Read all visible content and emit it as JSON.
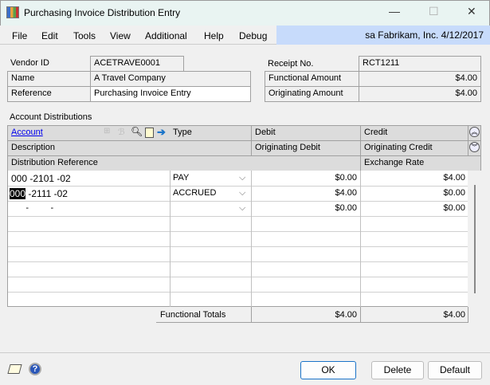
{
  "window": {
    "title": "Purchasing Invoice Distribution Entry",
    "minimize": "—",
    "maximize": "☐",
    "close": "✕"
  },
  "menu": {
    "items": [
      "File",
      "Edit",
      "Tools",
      "View",
      "Additional",
      "Help",
      "Debug"
    ],
    "user_info": "sa  Fabrikam, Inc.  4/12/2017"
  },
  "header": {
    "vendor_id_label": "Vendor ID",
    "vendor_id": "ACETRAVE0001",
    "name_label": "Name",
    "name": "A Travel Company",
    "reference_label": "Reference",
    "reference": "Purchasing Invoice Entry",
    "receipt_label": "Receipt No.",
    "receipt": "RCT1211",
    "functional_amount_label": "Functional Amount",
    "functional_amount": "$4.00",
    "originating_amount_label": "Originating Amount",
    "originating_amount": "$4.00"
  },
  "grid": {
    "section_label": "Account Distributions",
    "columns": {
      "account": "Account",
      "type": "Type",
      "debit": "Debit",
      "credit": "Credit",
      "description": "Description",
      "orig_debit": "Originating Debit",
      "orig_credit": "Originating Credit",
      "dist_ref": "Distribution Reference",
      "exchange_rate": "Exchange Rate"
    },
    "rows": [
      {
        "account": "000 -2101 -02",
        "type": "PAY",
        "debit": "$0.00",
        "credit": "$4.00"
      },
      {
        "account_selected": "000",
        "account_rest": " -2111 -02",
        "type": "ACCRUED",
        "debit": "$4.00",
        "credit": "$0.00"
      },
      {
        "account": "      -         -",
        "type": "",
        "debit": "$0.00",
        "credit": "$0.00"
      }
    ],
    "totals_label": "Functional Totals",
    "total_debit": "$4.00",
    "total_credit": "$4.00"
  },
  "buttons": {
    "ok": "OK",
    "delete": "Delete",
    "default": "Default"
  }
}
